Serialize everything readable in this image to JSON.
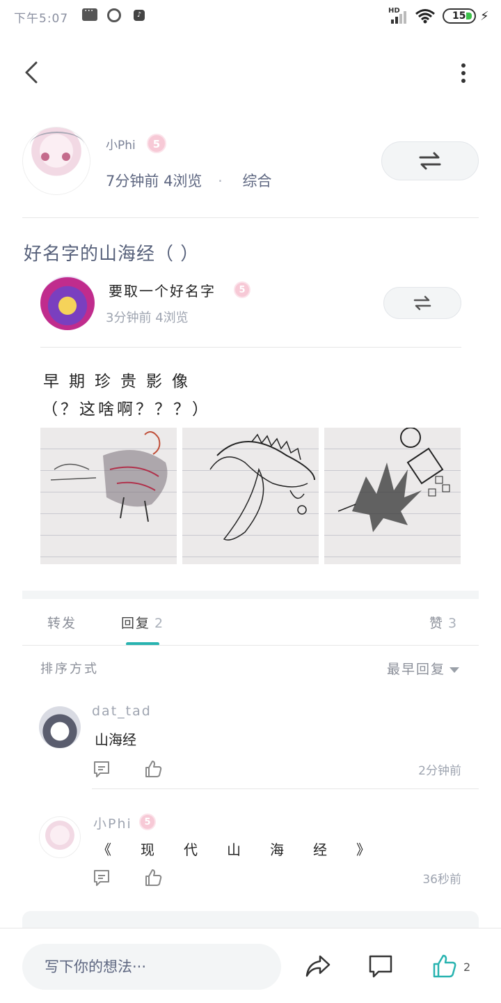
{
  "status_bar": {
    "time": "下午5:07",
    "network": "HD",
    "battery": "15"
  },
  "author": {
    "name": "小Phi",
    "level": "5",
    "time": "7分钟前",
    "views": "4浏览",
    "separator": "·",
    "category": "综合"
  },
  "post": {
    "title": "好名字的山海经（ ）",
    "quoted": {
      "name": "要取一个好名字",
      "level": "5",
      "time": "3分钟前",
      "views": "4浏览",
      "lines": [
        "早期珍贵影像",
        "（？这啥啊？？？）"
      ]
    }
  },
  "tabs": [
    {
      "label": "转发",
      "count": ""
    },
    {
      "label": "回复",
      "count": "2"
    },
    {
      "label": "赞",
      "count": "3"
    }
  ],
  "sort": {
    "label": "排序方式",
    "selected": "最早回复"
  },
  "comments": [
    {
      "name": "dat_tad",
      "level": "",
      "text": "山海经",
      "time": "2分钟前"
    },
    {
      "name": "小Phi",
      "level": "5",
      "text_parts": [
        "《",
        "现",
        "代",
        "山",
        "海",
        "经",
        "》"
      ],
      "time": "36秒前"
    }
  ],
  "bottom_bar": {
    "input_placeholder": "写下你的想法···",
    "like_count": "2"
  },
  "colors": {
    "accent": "#28b3b0",
    "text": "#222222",
    "muted": "#9ea4b0",
    "badge": "#f7c9d6"
  }
}
